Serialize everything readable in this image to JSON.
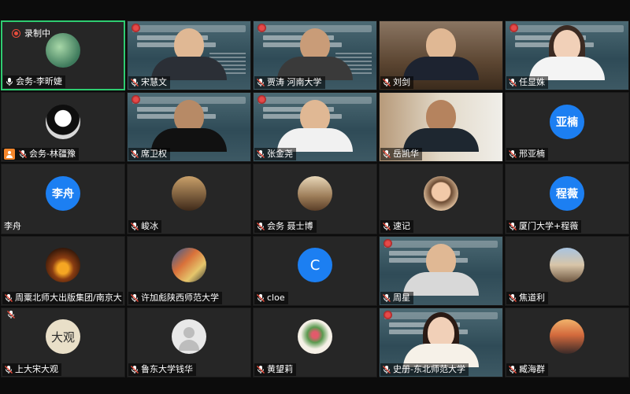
{
  "recording": {
    "label": "录制中"
  },
  "colors": {
    "active_border": "#2ecc71",
    "avatar_blue": "#1c7ff2",
    "mic_muted": "#e74c3c"
  },
  "participants": [
    {
      "name": "会务-李昕婕",
      "mic": "on",
      "active": true,
      "avatar": "garden-photo"
    },
    {
      "name": "宋慧文",
      "mic": "muted",
      "video": "slide"
    },
    {
      "name": "贾涛 河南大学",
      "mic": "muted",
      "video": "slide"
    },
    {
      "name": "刘剑",
      "mic": "muted",
      "video": "camera"
    },
    {
      "name": "任显姝",
      "mic": "muted",
      "video": "slide"
    },
    {
      "name": "会务-林疆豫",
      "mic": "muted",
      "host": true,
      "avatar": "bw-photo"
    },
    {
      "name": "席卫权",
      "mic": "muted",
      "video": "slide"
    },
    {
      "name": "张金尧",
      "mic": "muted",
      "video": "slide"
    },
    {
      "name": "岳凯华",
      "mic": "muted",
      "video": "camera"
    },
    {
      "name": "邢亚楠",
      "mic": "muted",
      "avatar_text": "亚楠"
    },
    {
      "name": "李舟",
      "mic": "none",
      "avatar_text": "李舟"
    },
    {
      "name": "峻冰",
      "mic": "muted",
      "avatar": "photo"
    },
    {
      "name": "会务 聂士博",
      "mic": "muted",
      "avatar": "photo"
    },
    {
      "name": "速记",
      "mic": "muted",
      "avatar": "photo"
    },
    {
      "name": "厦门大学+程薇",
      "mic": "muted",
      "avatar_text": "程薇"
    },
    {
      "name": "周粟北师大出版集团/南京大",
      "mic": "muted",
      "avatar": "photo"
    },
    {
      "name": "许加彪陕西师范大学",
      "mic": "muted",
      "avatar": "photo"
    },
    {
      "name": "cloe",
      "mic": "muted",
      "avatar_text": "C"
    },
    {
      "name": "周星",
      "mic": "muted",
      "video": "slide"
    },
    {
      "name": "焦道利",
      "mic": "muted",
      "avatar": "photo"
    },
    {
      "name": "上大宋大观",
      "mic": "muted",
      "avatar_text": "大观"
    },
    {
      "name": "鲁东大学钱华",
      "mic": "muted",
      "avatar": "default"
    },
    {
      "name": "黄望莉",
      "mic": "muted",
      "avatar": "photo"
    },
    {
      "name": "史册-东北师范大学",
      "mic": "muted",
      "video": "slide"
    },
    {
      "name": "臧海群",
      "mic": "muted",
      "avatar": "photo"
    }
  ]
}
